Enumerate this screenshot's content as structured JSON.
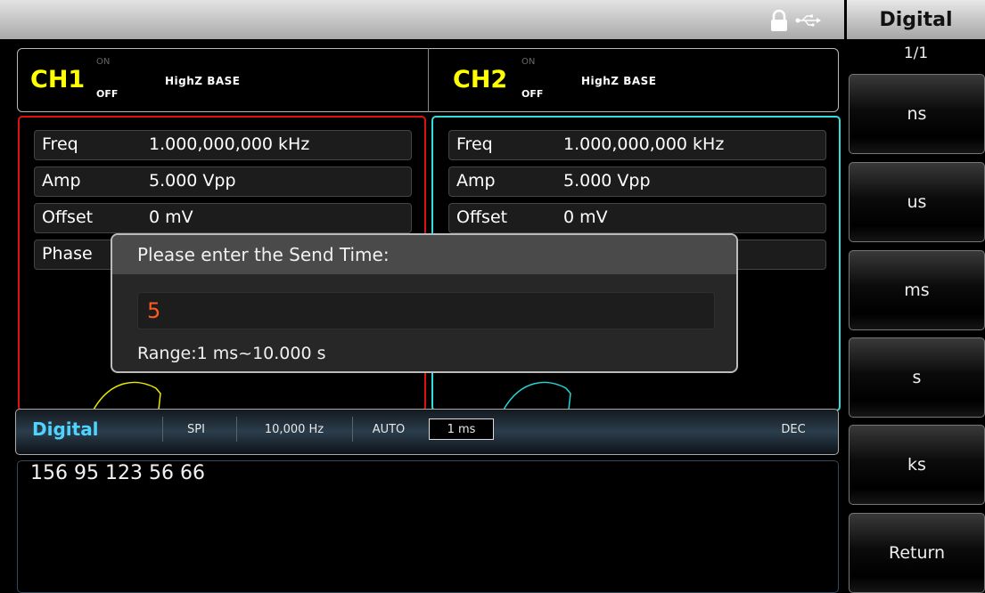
{
  "menu": {
    "title": "Digital",
    "page": "1/1",
    "softkeys": [
      "ns",
      "us",
      "ms",
      "s",
      "ks",
      "Return"
    ]
  },
  "status": {
    "icons": [
      "lock-icon",
      "usb-icon"
    ]
  },
  "channels": [
    {
      "name": "CH1",
      "on_label": "ON",
      "off_label": "OFF",
      "load": "HighZ",
      "mode": "BASE",
      "color": "#ffff00",
      "border_color": "#dd1111",
      "wave_color": "#e8e800"
    },
    {
      "name": "CH2",
      "on_label": "ON",
      "off_label": "OFF",
      "load": "HighZ",
      "mode": "BASE",
      "color": "#ffff00",
      "border_color": "#33dddd",
      "wave_color": "#22d5d5"
    }
  ],
  "params": {
    "ch1": [
      {
        "label": "Freq",
        "value": "1.000,000,000 kHz"
      },
      {
        "label": "Amp",
        "value": "5.000 Vpp"
      },
      {
        "label": "Offset",
        "value": "0 mV"
      },
      {
        "label": "Phase",
        "value": ""
      }
    ],
    "ch2": [
      {
        "label": "Freq",
        "value": "1.000,000,000 kHz"
      },
      {
        "label": "Amp",
        "value": "5.000 Vpp"
      },
      {
        "label": "Offset",
        "value": "0 mV"
      },
      {
        "label": "",
        "value": ""
      }
    ]
  },
  "digital": {
    "label": "Digital",
    "protocol": "SPI",
    "rate": "10,000 Hz",
    "mode": "AUTO",
    "send_time": "1 ms",
    "format": "DEC",
    "data": "156 95 123 56 66",
    "accent_color": "#4fd3ff"
  },
  "dialog": {
    "title": "Please enter the Send Time:",
    "input_value": "5",
    "range": "Range:1 ms~10.000 s",
    "input_color": "#ff5a20"
  }
}
